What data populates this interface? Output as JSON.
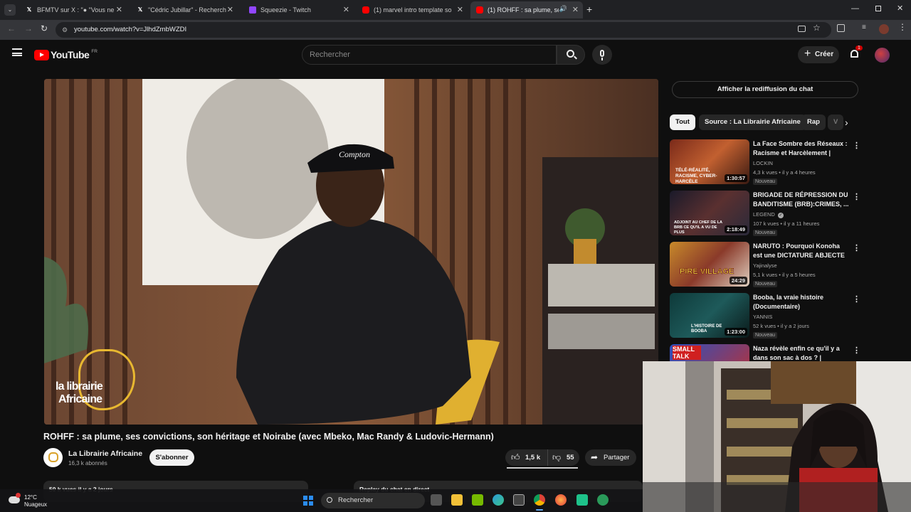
{
  "browser": {
    "tabs": [
      {
        "label": "BFMTV sur X : \"● \"Vous ne se",
        "icon": "x-logo-icon"
      },
      {
        "label": "\"Cédric Jubillar\" - Recherche / X",
        "icon": "x-logo-icon"
      },
      {
        "label": "Squeezie - Twitch",
        "icon": "twitch-icon"
      },
      {
        "label": "(1) marvel intro template sony",
        "icon": "youtube-icon"
      },
      {
        "label": "(1) ROHFF : sa plume, ses c",
        "icon": "youtube-icon"
      }
    ],
    "url": "youtube.com/watch?v=JlhdZmbWZDI"
  },
  "youtube": {
    "logo": "YouTube",
    "region": "FR",
    "search_placeholder": "Rechercher",
    "create_label": "Créer",
    "notification_count": "1"
  },
  "video": {
    "overlay_logo_line1": "la librairie",
    "overlay_logo_line2": "Africaine",
    "cap_text": "Compton",
    "title": "ROHFF : sa plume, ses convictions, son héritage et Noirabe (avec Mbeko, Mac Randy & Ludovic-Hermann)",
    "channel": "La Librairie Africaine",
    "subscribers": "16,3 k abonnés",
    "subscribe_label": "S'abonner",
    "likes": "1,5 k",
    "dislikes": "55",
    "share_label": "Partager",
    "desc_meta": "50 k vues  il y a 2 jours",
    "chat_replay_label": "Replay du chat en direct"
  },
  "sidebar": {
    "chat_button": "Afficher la rediffusion du chat",
    "chips": [
      "Tout",
      "Source : La Librairie Africaine",
      "Rap",
      "V"
    ],
    "recommendations": [
      {
        "title": "La Face Sombre des Réseaux : Racisme et Harcèlement | feat...",
        "channel": "LOCKIN",
        "meta": "4,3 k vues • il y a 4 heures",
        "badge": "Nouveau",
        "duration": "1:30:57",
        "thumb_text": "TÉLÉ-RÉALITÉ, RACISME, CYBER-HARCÈLE"
      },
      {
        "title": "BRIGADE DE RÉPRESSION DU BANDITISME (BRB):CRIMES, ...",
        "channel": "LEGEND",
        "meta": "107 k vues • il y a 11 heures",
        "badge": "Nouveau",
        "duration": "2:18:49",
        "thumb_text": "ADJOINT AU CHEF DE LA BRB CE QU'IL A VU DE PLUS"
      },
      {
        "title": "NARUTO : Pourquoi Konoha est une DICTATURE ABJECTE",
        "channel": "Yajinalyse",
        "meta": "5,1 k vues • il y a 5 heures",
        "badge": "Nouveau",
        "duration": "24:29",
        "thumb_text": "PIRE VILLAGE"
      },
      {
        "title": "Booba, la vraie histoire (Documentaire)",
        "channel": "YANNIS",
        "meta": "52 k vues • il y a 2 jours",
        "badge": "Nouveau",
        "duration": "1:23:00",
        "thumb_text": "L'HISTOIRE DE BOOBA"
      },
      {
        "title": "Naza révèle enfin ce qu'il y a dans son sac à dos ? |",
        "channel": "",
        "meta": "",
        "badge": "",
        "duration": "",
        "thumb_text": "SMALL TALK"
      }
    ]
  },
  "taskbar": {
    "weather_temp": "12°C",
    "weather_desc": "Nuageux",
    "search_label": "Rechercher"
  },
  "colors": {
    "youtube_red": "#ff0000",
    "bg": "#0f0f0f",
    "chip_bg": "#272727",
    "tab_active": "#35363a"
  }
}
